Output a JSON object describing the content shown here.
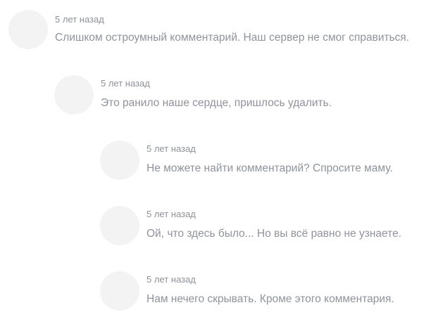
{
  "comments": [
    {
      "timestamp": "5 лет назад",
      "text": "Слишком остроумный комментарий. Наш сервер не смог справиться."
    },
    {
      "timestamp": "5 лет назад",
      "text": "Это ранило наше сердце, пришлось удалить."
    },
    {
      "timestamp": "5 лет назад",
      "text": "Не можете найти комментарий? Спросите маму."
    },
    {
      "timestamp": "5 лет назад",
      "text": "Ой, что здесь было... Но вы всё равно не узнаете."
    },
    {
      "timestamp": "5 лет назад",
      "text": "Нам нечего скрывать. Кроме этого комментария."
    }
  ],
  "colors": {
    "avatar_placeholder": "#f3f3f4",
    "text": "#8f939a",
    "timestamp": "#8e9297"
  }
}
